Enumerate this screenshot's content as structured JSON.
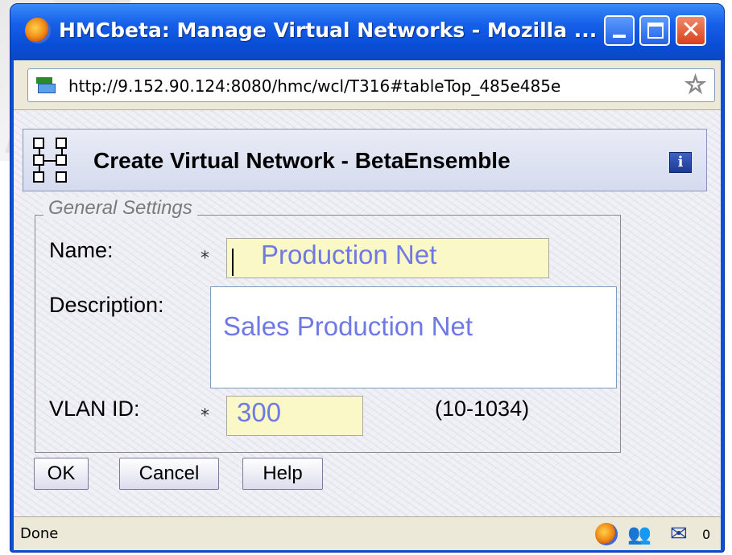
{
  "window": {
    "title": "HMCbeta: Manage Virtual Networks - Mozilla ...",
    "url": "http://9.152.90.124:8080/hmc/wcl/T316#tableTop_485e485e"
  },
  "dialog": {
    "title": "Create Virtual Network - BetaEnsemble",
    "info_label": "i"
  },
  "general_settings": {
    "legend": "General Settings",
    "name_label": "Name:",
    "name_value": "Production Net",
    "description_label": "Description:",
    "description_value": "Sales Production Net",
    "vlan_label": "VLAN ID:",
    "vlan_value": "300",
    "vlan_range": "(10-1034)",
    "required_marker": "*"
  },
  "buttons": {
    "ok": "OK",
    "cancel": "Cancel",
    "help": "Help"
  },
  "status": {
    "text": "Done",
    "mail_count": "0"
  },
  "icons": {
    "app": "firefox-icon",
    "page": "page-icon",
    "bookmark": "star-icon",
    "dialog": "tree-icon",
    "info": "info-icon"
  },
  "colors": {
    "titlebar": "#0a4fd8",
    "input_value_text": "#6f79e6",
    "required_field_bg": "#fbf8c8"
  }
}
